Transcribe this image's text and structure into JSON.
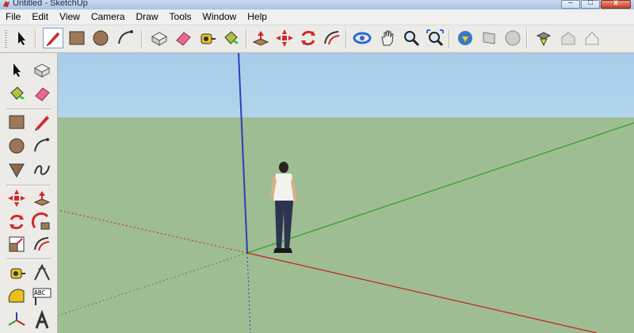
{
  "window": {
    "title": "Untitled - SketchUp"
  },
  "menu": [
    "File",
    "Edit",
    "View",
    "Camera",
    "Draw",
    "Tools",
    "Window",
    "Help"
  ],
  "toolbar_icons": [
    "select-icon",
    "pencil-line-icon",
    "rectangle-icon",
    "circle-icon",
    "arc-icon",
    "make-component-icon",
    "eraser-icon",
    "tape-measure-icon",
    "paint-bucket-icon",
    "push-pull-icon",
    "move-icon",
    "rotate-icon",
    "offset-icon",
    "orbit-icon",
    "pan-icon",
    "zoom-icon",
    "zoom-extents-icon",
    "get-models-icon",
    "share-model-icon",
    "share-component-icon",
    "get-photo-texture-icon",
    "3d-warehouse-icon",
    "shadow-icon"
  ],
  "left_tools": [
    "select-icon",
    "make-component-icon",
    "paint-bucket-icon",
    "eraser-icon",
    "rectangle-icon",
    "pencil-line-icon",
    "circle-icon",
    "arc-icon",
    "polygon-icon",
    "freehand-icon",
    "move-icon",
    "push-pull-icon",
    "rotate-icon",
    "follow-me-icon",
    "scale-icon",
    "offset-icon",
    "tape-measure-icon",
    "dimension-icon",
    "protractor-icon",
    "text-icon",
    "axes-icon",
    "3d-text-icon"
  ],
  "label_abc": "ABC",
  "colors": {
    "axis_red": "#c0241c",
    "axis_green": "#2aa028",
    "axis_blue": "#2a3fb8",
    "sky_top": "#a7cdea",
    "ground": "#9fbd92"
  }
}
